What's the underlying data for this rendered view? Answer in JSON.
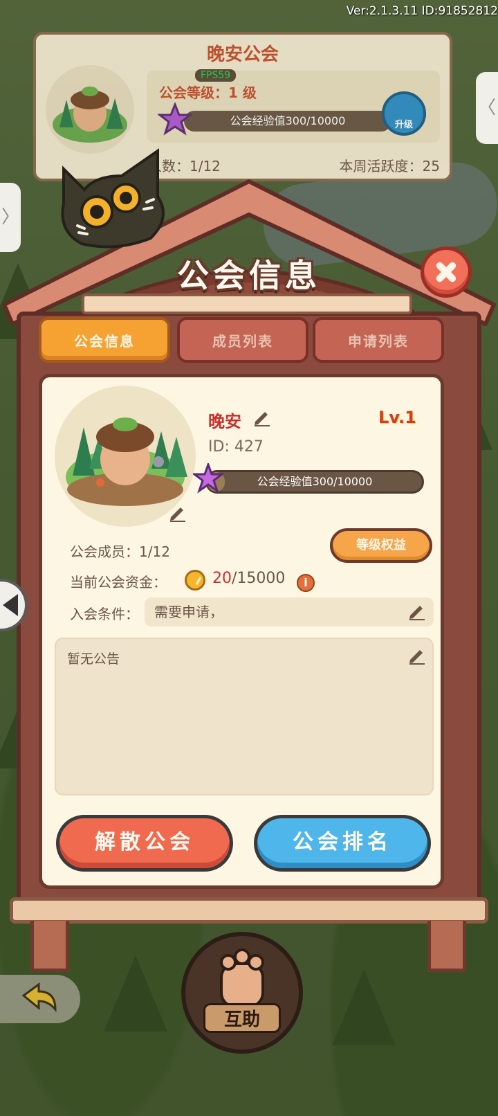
{
  "hud": {
    "version": "Ver:2.1.3.11 ID:91852812"
  },
  "top_card": {
    "guild_name": "晚安公会",
    "fps": "FPS59",
    "level": "公会等级：1 级",
    "exp": "公会经验值300/10000",
    "upgrade": "升级",
    "members": "人数：1/12",
    "activity": "本周活跃度：25"
  },
  "panel": {
    "title": "公会信息",
    "tabs": [
      {
        "label": "公会信息",
        "active": true
      },
      {
        "label": "成员列表",
        "active": false
      },
      {
        "label": "申请列表",
        "active": false
      }
    ]
  },
  "guild": {
    "name": "晚安",
    "level": "Lv.1",
    "id": "ID: 427",
    "exp_label": "公会经验值300/10000",
    "exp_fraction": 0.03,
    "members_label": "公会成员：",
    "members_value": "1/12",
    "level_benefits": "等级权益",
    "funds_label": "当前公会资金：",
    "funds_current": "20",
    "funds_total": "/15000",
    "join_label": "入会条件：",
    "join_value": "需要申请，",
    "notice": "暂无公告"
  },
  "buttons": {
    "disband": "解散公会",
    "ranking": "公会排名"
  },
  "bottom": {
    "help": "互助"
  },
  "colors": {
    "accent": "#f6a233",
    "danger": "#f06a4f",
    "primary": "#4fb6ec",
    "wood": "#8b4a3e"
  }
}
